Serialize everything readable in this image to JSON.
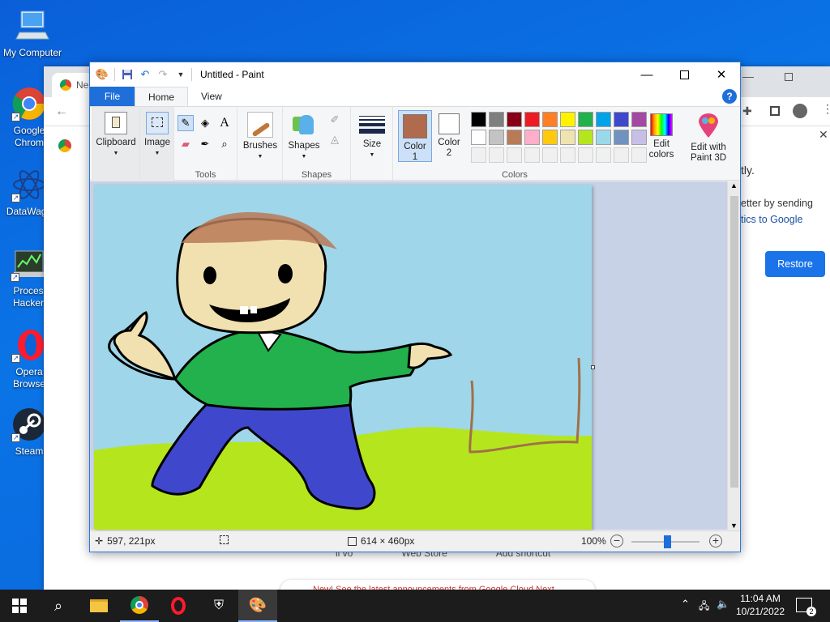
{
  "desktop": {
    "icons": [
      {
        "label": "My Computer"
      },
      {
        "label": "Google Chrom"
      },
      {
        "label": "DataWago"
      },
      {
        "label": "Proces Hacker"
      },
      {
        "label": "Opera Browse"
      },
      {
        "label": "Steam"
      }
    ]
  },
  "chrome": {
    "tab_text": "Ne",
    "popup_text_1": "tly.",
    "popup_text_2": "etter by sending",
    "popup_text_3": "tics to Google",
    "restore_label": "Restore",
    "bottom_labels": [
      "ll vo",
      "Web Store",
      "Add shortcut"
    ],
    "banner_text": "New! See the latest announcements from Google Cloud Next"
  },
  "paint": {
    "title": "Untitled - Paint",
    "tabs": {
      "file": "File",
      "home": "Home",
      "view": "View"
    },
    "help": "?",
    "ribbon": {
      "clipboard": "Clipboard",
      "image": "Image",
      "tools": "Tools",
      "brushes": "Brushes",
      "shapes_btn": "Shapes",
      "shapes_group": "Shapes",
      "size": "Size",
      "color1": "Color 1",
      "color2": "Color 2",
      "edit_colors": "Edit colors",
      "paint3d": "Edit with Paint 3D",
      "colors_group": "Colors"
    },
    "color1_value": "#b06a4e",
    "color2_value": "#ffffff",
    "palette_row1": [
      "#000000",
      "#7f7f7f",
      "#880015",
      "#ed1c24",
      "#ff7f27",
      "#fff200",
      "#22b14c",
      "#00a2e8",
      "#3f48cc",
      "#a349a4"
    ],
    "palette_row2": [
      "#ffffff",
      "#c3c3c3",
      "#b97a57",
      "#ffaec9",
      "#ffc90e",
      "#efe4b0",
      "#b5e61d",
      "#99d9ea",
      "#7092be",
      "#c8bfe7"
    ],
    "status": {
      "cursor_pos": "597, 221px",
      "canvas_size": "614 × 460px",
      "zoom": "100%"
    }
  },
  "taskbar": {
    "time": "11:04 AM",
    "date": "10/21/2022",
    "notification_count": "2"
  }
}
